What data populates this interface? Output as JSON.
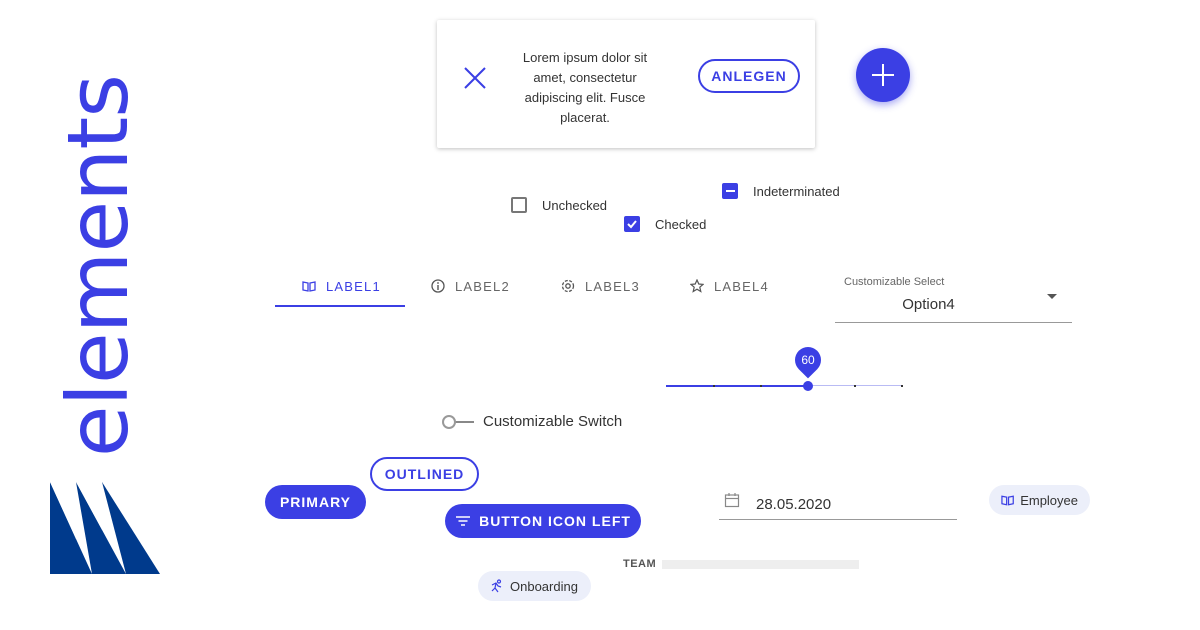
{
  "brand": {
    "wordmark": "elements",
    "color": "#3b3fe4",
    "logo_color": "#003a8c"
  },
  "snackbar": {
    "message": "Lorem ipsum dolor sit amet, consectetur adipiscing elit. Fusce placerat.",
    "action_label": "ANLEGEN",
    "close_icon": "close-icon"
  },
  "fab": {
    "icon": "plus-icon"
  },
  "checkboxes": [
    {
      "label": "Unchecked",
      "state": "unchecked"
    },
    {
      "label": "Checked",
      "state": "checked"
    },
    {
      "label": "Indeterminated",
      "state": "indeterminate"
    }
  ],
  "tabs": [
    {
      "label": "LABEL1",
      "icon": "book-icon",
      "active": true
    },
    {
      "label": "LABEL2",
      "icon": "info-icon",
      "active": false
    },
    {
      "label": "LABEL3",
      "icon": "settings-icon",
      "active": false
    },
    {
      "label": "LABEL4",
      "icon": "star-icon",
      "active": false
    }
  ],
  "select": {
    "label": "Customizable Select",
    "value": "Option4"
  },
  "slider": {
    "value": "60"
  },
  "switch": {
    "label": "Customizable Switch",
    "checked": false
  },
  "buttons": {
    "primary": "PRIMARY",
    "outlined": "OUTLINED",
    "icon_left": "BUTTON ICON LEFT"
  },
  "date_field": {
    "value": "28.05.2020",
    "icon": "calendar-icon"
  },
  "chips": {
    "employee": {
      "label": "Employee",
      "icon": "book-icon"
    },
    "onboarding": {
      "label": "Onboarding",
      "icon": "run-icon"
    }
  },
  "team": {
    "label": "TEAM"
  },
  "accent": "#3b3fe4"
}
